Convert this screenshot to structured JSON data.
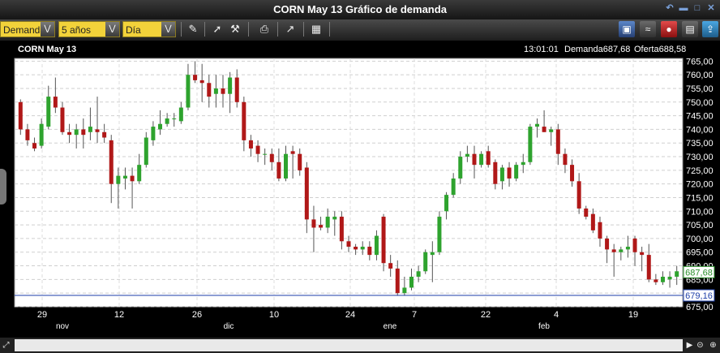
{
  "window": {
    "title": "CORN May 13 Gráfico de demanda"
  },
  "toolbar": {
    "price_type": "Demanda",
    "period": "5 años",
    "interval": "Día"
  },
  "header": {
    "symbol": "CORN May 13",
    "time": "13:01:01",
    "bid_label": "Demanda",
    "bid_value": "687,68",
    "ask_label": "Oferta",
    "ask_value": "688,58"
  },
  "chart_data": {
    "type": "candlestick",
    "y_ticks": [
      "765,00",
      "760,00",
      "755,00",
      "750,00",
      "745,00",
      "740,00",
      "735,00",
      "730,00",
      "725,00",
      "720,00",
      "715,00",
      "710,00",
      "705,00",
      "700,00",
      "695,00",
      "690,00",
      "685,00",
      "680,00",
      "675,00"
    ],
    "ylim": [
      675,
      766
    ],
    "x_ticks": [
      {
        "day": "29",
        "month": "nov"
      },
      {
        "day": "12",
        "month": ""
      },
      {
        "day": "26",
        "month": "dic"
      },
      {
        "day": "10",
        "month": ""
      },
      {
        "day": "24",
        "month": "ene"
      },
      {
        "day": "7",
        "month": ""
      },
      {
        "day": "22",
        "month": "feb"
      },
      {
        "day": "4",
        "month": ""
      },
      {
        "day": "19",
        "month": ""
      }
    ],
    "month_labels": [
      "nov",
      "dic",
      "ene",
      "feb"
    ],
    "current_price": "687,68",
    "reference_line": "679,16",
    "colors": {
      "up": "#2ea32e",
      "down": "#b01818",
      "current": "#2a8f2a",
      "reference": "#1d3ea8"
    },
    "candles": [
      {
        "o": 750,
        "h": 751,
        "l": 738,
        "c": 740
      },
      {
        "o": 740,
        "h": 742,
        "l": 734,
        "c": 736
      },
      {
        "o": 735,
        "h": 737,
        "l": 732,
        "c": 733
      },
      {
        "o": 734,
        "h": 744,
        "l": 733,
        "c": 742
      },
      {
        "o": 741,
        "h": 756,
        "l": 740,
        "c": 752
      },
      {
        "o": 752,
        "h": 759,
        "l": 746,
        "c": 748
      },
      {
        "o": 748,
        "h": 750,
        "l": 738,
        "c": 739
      },
      {
        "o": 739,
        "h": 742,
        "l": 735,
        "c": 738
      },
      {
        "o": 738,
        "h": 742,
        "l": 733,
        "c": 740
      },
      {
        "o": 740,
        "h": 744,
        "l": 733,
        "c": 738
      },
      {
        "o": 739,
        "h": 748,
        "l": 736,
        "c": 741
      },
      {
        "o": 740,
        "h": 752,
        "l": 735,
        "c": 739
      },
      {
        "o": 739,
        "h": 742,
        "l": 735,
        "c": 737
      },
      {
        "o": 736,
        "h": 738,
        "l": 713,
        "c": 720
      },
      {
        "o": 720,
        "h": 726,
        "l": 711,
        "c": 723
      },
      {
        "o": 722,
        "h": 726,
        "l": 718,
        "c": 723
      },
      {
        "o": 723,
        "h": 726,
        "l": 711,
        "c": 721
      },
      {
        "o": 721,
        "h": 731,
        "l": 720,
        "c": 727
      },
      {
        "o": 727,
        "h": 739,
        "l": 726,
        "c": 737
      },
      {
        "o": 736,
        "h": 743,
        "l": 734,
        "c": 741
      },
      {
        "o": 740,
        "h": 747,
        "l": 738,
        "c": 742
      },
      {
        "o": 742,
        "h": 746,
        "l": 741,
        "c": 744
      },
      {
        "o": 744,
        "h": 746,
        "l": 741,
        "c": 744
      },
      {
        "o": 743,
        "h": 750,
        "l": 742,
        "c": 748
      },
      {
        "o": 748,
        "h": 764,
        "l": 747,
        "c": 760
      },
      {
        "o": 760,
        "h": 765,
        "l": 757,
        "c": 758
      },
      {
        "o": 758,
        "h": 764,
        "l": 750,
        "c": 757
      },
      {
        "o": 757,
        "h": 760,
        "l": 748,
        "c": 752
      },
      {
        "o": 753,
        "h": 760,
        "l": 748,
        "c": 755
      },
      {
        "o": 755,
        "h": 760,
        "l": 748,
        "c": 753
      },
      {
        "o": 753,
        "h": 761,
        "l": 746,
        "c": 759
      },
      {
        "o": 759,
        "h": 762,
        "l": 748,
        "c": 750
      },
      {
        "o": 750,
        "h": 752,
        "l": 732,
        "c": 736
      },
      {
        "o": 736,
        "h": 738,
        "l": 730,
        "c": 733
      },
      {
        "o": 734,
        "h": 736,
        "l": 728,
        "c": 731
      },
      {
        "o": 731,
        "h": 733,
        "l": 727,
        "c": 731
      },
      {
        "o": 731,
        "h": 733,
        "l": 725,
        "c": 728
      },
      {
        "o": 728,
        "h": 733,
        "l": 721,
        "c": 722
      },
      {
        "o": 722,
        "h": 734,
        "l": 721,
        "c": 731
      },
      {
        "o": 732,
        "h": 734,
        "l": 722,
        "c": 731
      },
      {
        "o": 731,
        "h": 733,
        "l": 723,
        "c": 725
      },
      {
        "o": 726,
        "h": 728,
        "l": 702,
        "c": 707
      },
      {
        "o": 707,
        "h": 712,
        "l": 695,
        "c": 704
      },
      {
        "o": 705,
        "h": 708,
        "l": 703,
        "c": 704
      },
      {
        "o": 704,
        "h": 711,
        "l": 702,
        "c": 708
      },
      {
        "o": 707,
        "h": 710,
        "l": 701,
        "c": 708
      },
      {
        "o": 708,
        "h": 710,
        "l": 696,
        "c": 699
      },
      {
        "o": 699,
        "h": 701,
        "l": 695,
        "c": 697
      },
      {
        "o": 697,
        "h": 698,
        "l": 694,
        "c": 696
      },
      {
        "o": 696,
        "h": 699,
        "l": 694,
        "c": 697
      },
      {
        "o": 697,
        "h": 699,
        "l": 692,
        "c": 694
      },
      {
        "o": 694,
        "h": 703,
        "l": 692,
        "c": 701
      },
      {
        "o": 708,
        "h": 709,
        "l": 688,
        "c": 691
      },
      {
        "o": 691,
        "h": 694,
        "l": 686,
        "c": 689
      },
      {
        "o": 689,
        "h": 692,
        "l": 679,
        "c": 680
      },
      {
        "o": 680,
        "h": 686,
        "l": 679,
        "c": 682
      },
      {
        "o": 682,
        "h": 689,
        "l": 681,
        "c": 686
      },
      {
        "o": 686,
        "h": 690,
        "l": 684,
        "c": 688
      },
      {
        "o": 688,
        "h": 696,
        "l": 687,
        "c": 695
      },
      {
        "o": 694,
        "h": 699,
        "l": 684,
        "c": 695
      },
      {
        "o": 695,
        "h": 710,
        "l": 694,
        "c": 708
      },
      {
        "o": 710,
        "h": 717,
        "l": 707,
        "c": 716
      },
      {
        "o": 716,
        "h": 724,
        "l": 715,
        "c": 722
      },
      {
        "o": 722,
        "h": 732,
        "l": 720,
        "c": 730
      },
      {
        "o": 730,
        "h": 734,
        "l": 728,
        "c": 731
      },
      {
        "o": 731,
        "h": 734,
        "l": 722,
        "c": 727
      },
      {
        "o": 727,
        "h": 732,
        "l": 726,
        "c": 731
      },
      {
        "o": 732,
        "h": 734,
        "l": 726,
        "c": 727
      },
      {
        "o": 728,
        "h": 729,
        "l": 718,
        "c": 720
      },
      {
        "o": 721,
        "h": 727,
        "l": 718,
        "c": 726
      },
      {
        "o": 726,
        "h": 728,
        "l": 719,
        "c": 722
      },
      {
        "o": 722,
        "h": 728,
        "l": 721,
        "c": 727
      },
      {
        "o": 727,
        "h": 731,
        "l": 724,
        "c": 728
      },
      {
        "o": 728,
        "h": 742,
        "l": 727,
        "c": 741
      },
      {
        "o": 741,
        "h": 744,
        "l": 737,
        "c": 742
      },
      {
        "o": 741,
        "h": 747,
        "l": 739,
        "c": 739
      },
      {
        "o": 739,
        "h": 741,
        "l": 734,
        "c": 740
      },
      {
        "o": 740,
        "h": 742,
        "l": 727,
        "c": 731
      },
      {
        "o": 731,
        "h": 733,
        "l": 724,
        "c": 727
      },
      {
        "o": 727,
        "h": 729,
        "l": 719,
        "c": 721
      },
      {
        "o": 721,
        "h": 724,
        "l": 709,
        "c": 711
      },
      {
        "o": 711,
        "h": 712,
        "l": 707,
        "c": 708
      },
      {
        "o": 709,
        "h": 711,
        "l": 702,
        "c": 703
      },
      {
        "o": 706,
        "h": 708,
        "l": 697,
        "c": 700
      },
      {
        "o": 700,
        "h": 701,
        "l": 691,
        "c": 696
      },
      {
        "o": 696,
        "h": 698,
        "l": 686,
        "c": 695
      },
      {
        "o": 695,
        "h": 697,
        "l": 692,
        "c": 696
      },
      {
        "o": 696,
        "h": 701,
        "l": 693,
        "c": 697
      },
      {
        "o": 700,
        "h": 701,
        "l": 690,
        "c": 695
      },
      {
        "o": 695,
        "h": 697,
        "l": 688,
        "c": 694
      },
      {
        "o": 694,
        "h": 698,
        "l": 684,
        "c": 685
      },
      {
        "o": 685,
        "h": 687,
        "l": 683,
        "c": 684
      },
      {
        "o": 684,
        "h": 688,
        "l": 683,
        "c": 686
      },
      {
        "o": 685,
        "h": 688,
        "l": 682,
        "c": 686
      },
      {
        "o": 686,
        "h": 690,
        "l": 683,
        "c": 688
      }
    ]
  }
}
